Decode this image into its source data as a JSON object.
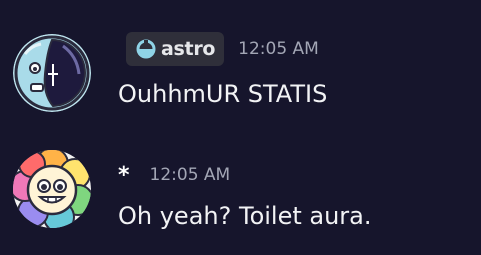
{
  "messages": [
    {
      "author": "",
      "tag": {
        "icon": "astro-tag-icon",
        "label": "astro"
      },
      "timestamp": "12:05 AM",
      "text": "OuhhmUR STATIS",
      "avatar": "astronaut-helmet-avatar"
    },
    {
      "author": "*",
      "timestamp": "12:05 AM",
      "text": "Oh yeah? Toilet aura.",
      "avatar": "rainbow-flower-smiley-avatar"
    }
  ],
  "colors": {
    "background": "#16152c",
    "text": "#f2f3f5",
    "timestamp": "#a3a6b5",
    "tag_background": "#2f2f3a",
    "tag_icon": "#8fd3e6"
  }
}
